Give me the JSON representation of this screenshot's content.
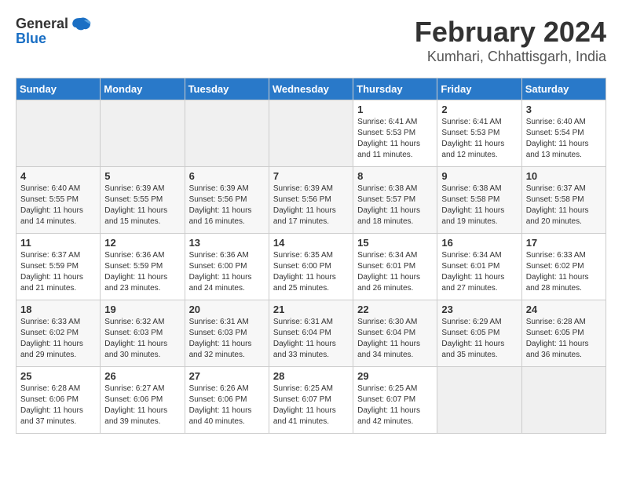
{
  "header": {
    "logo_general": "General",
    "logo_blue": "Blue",
    "title": "February 2024",
    "subtitle": "Kumhari, Chhattisgarh, India"
  },
  "weekdays": [
    "Sunday",
    "Monday",
    "Tuesday",
    "Wednesday",
    "Thursday",
    "Friday",
    "Saturday"
  ],
  "weeks": [
    [
      {
        "day": "",
        "empty": true
      },
      {
        "day": "",
        "empty": true
      },
      {
        "day": "",
        "empty": true
      },
      {
        "day": "",
        "empty": true
      },
      {
        "day": "1",
        "sunrise": "6:41 AM",
        "sunset": "5:53 PM",
        "daylight": "11 hours and 11 minutes."
      },
      {
        "day": "2",
        "sunrise": "6:41 AM",
        "sunset": "5:53 PM",
        "daylight": "11 hours and 12 minutes."
      },
      {
        "day": "3",
        "sunrise": "6:40 AM",
        "sunset": "5:54 PM",
        "daylight": "11 hours and 13 minutes."
      }
    ],
    [
      {
        "day": "4",
        "sunrise": "6:40 AM",
        "sunset": "5:55 PM",
        "daylight": "11 hours and 14 minutes."
      },
      {
        "day": "5",
        "sunrise": "6:39 AM",
        "sunset": "5:55 PM",
        "daylight": "11 hours and 15 minutes."
      },
      {
        "day": "6",
        "sunrise": "6:39 AM",
        "sunset": "5:56 PM",
        "daylight": "11 hours and 16 minutes."
      },
      {
        "day": "7",
        "sunrise": "6:39 AM",
        "sunset": "5:56 PM",
        "daylight": "11 hours and 17 minutes."
      },
      {
        "day": "8",
        "sunrise": "6:38 AM",
        "sunset": "5:57 PM",
        "daylight": "11 hours and 18 minutes."
      },
      {
        "day": "9",
        "sunrise": "6:38 AM",
        "sunset": "5:58 PM",
        "daylight": "11 hours and 19 minutes."
      },
      {
        "day": "10",
        "sunrise": "6:37 AM",
        "sunset": "5:58 PM",
        "daylight": "11 hours and 20 minutes."
      }
    ],
    [
      {
        "day": "11",
        "sunrise": "6:37 AM",
        "sunset": "5:59 PM",
        "daylight": "11 hours and 21 minutes."
      },
      {
        "day": "12",
        "sunrise": "6:36 AM",
        "sunset": "5:59 PM",
        "daylight": "11 hours and 23 minutes."
      },
      {
        "day": "13",
        "sunrise": "6:36 AM",
        "sunset": "6:00 PM",
        "daylight": "11 hours and 24 minutes."
      },
      {
        "day": "14",
        "sunrise": "6:35 AM",
        "sunset": "6:00 PM",
        "daylight": "11 hours and 25 minutes."
      },
      {
        "day": "15",
        "sunrise": "6:34 AM",
        "sunset": "6:01 PM",
        "daylight": "11 hours and 26 minutes."
      },
      {
        "day": "16",
        "sunrise": "6:34 AM",
        "sunset": "6:01 PM",
        "daylight": "11 hours and 27 minutes."
      },
      {
        "day": "17",
        "sunrise": "6:33 AM",
        "sunset": "6:02 PM",
        "daylight": "11 hours and 28 minutes."
      }
    ],
    [
      {
        "day": "18",
        "sunrise": "6:33 AM",
        "sunset": "6:02 PM",
        "daylight": "11 hours and 29 minutes."
      },
      {
        "day": "19",
        "sunrise": "6:32 AM",
        "sunset": "6:03 PM",
        "daylight": "11 hours and 30 minutes."
      },
      {
        "day": "20",
        "sunrise": "6:31 AM",
        "sunset": "6:03 PM",
        "daylight": "11 hours and 32 minutes."
      },
      {
        "day": "21",
        "sunrise": "6:31 AM",
        "sunset": "6:04 PM",
        "daylight": "11 hours and 33 minutes."
      },
      {
        "day": "22",
        "sunrise": "6:30 AM",
        "sunset": "6:04 PM",
        "daylight": "11 hours and 34 minutes."
      },
      {
        "day": "23",
        "sunrise": "6:29 AM",
        "sunset": "6:05 PM",
        "daylight": "11 hours and 35 minutes."
      },
      {
        "day": "24",
        "sunrise": "6:28 AM",
        "sunset": "6:05 PM",
        "daylight": "11 hours and 36 minutes."
      }
    ],
    [
      {
        "day": "25",
        "sunrise": "6:28 AM",
        "sunset": "6:06 PM",
        "daylight": "11 hours and 37 minutes."
      },
      {
        "day": "26",
        "sunrise": "6:27 AM",
        "sunset": "6:06 PM",
        "daylight": "11 hours and 39 minutes."
      },
      {
        "day": "27",
        "sunrise": "6:26 AM",
        "sunset": "6:06 PM",
        "daylight": "11 hours and 40 minutes."
      },
      {
        "day": "28",
        "sunrise": "6:25 AM",
        "sunset": "6:07 PM",
        "daylight": "11 hours and 41 minutes."
      },
      {
        "day": "29",
        "sunrise": "6:25 AM",
        "sunset": "6:07 PM",
        "daylight": "11 hours and 42 minutes."
      },
      {
        "day": "",
        "empty": true
      },
      {
        "day": "",
        "empty": true
      }
    ]
  ]
}
